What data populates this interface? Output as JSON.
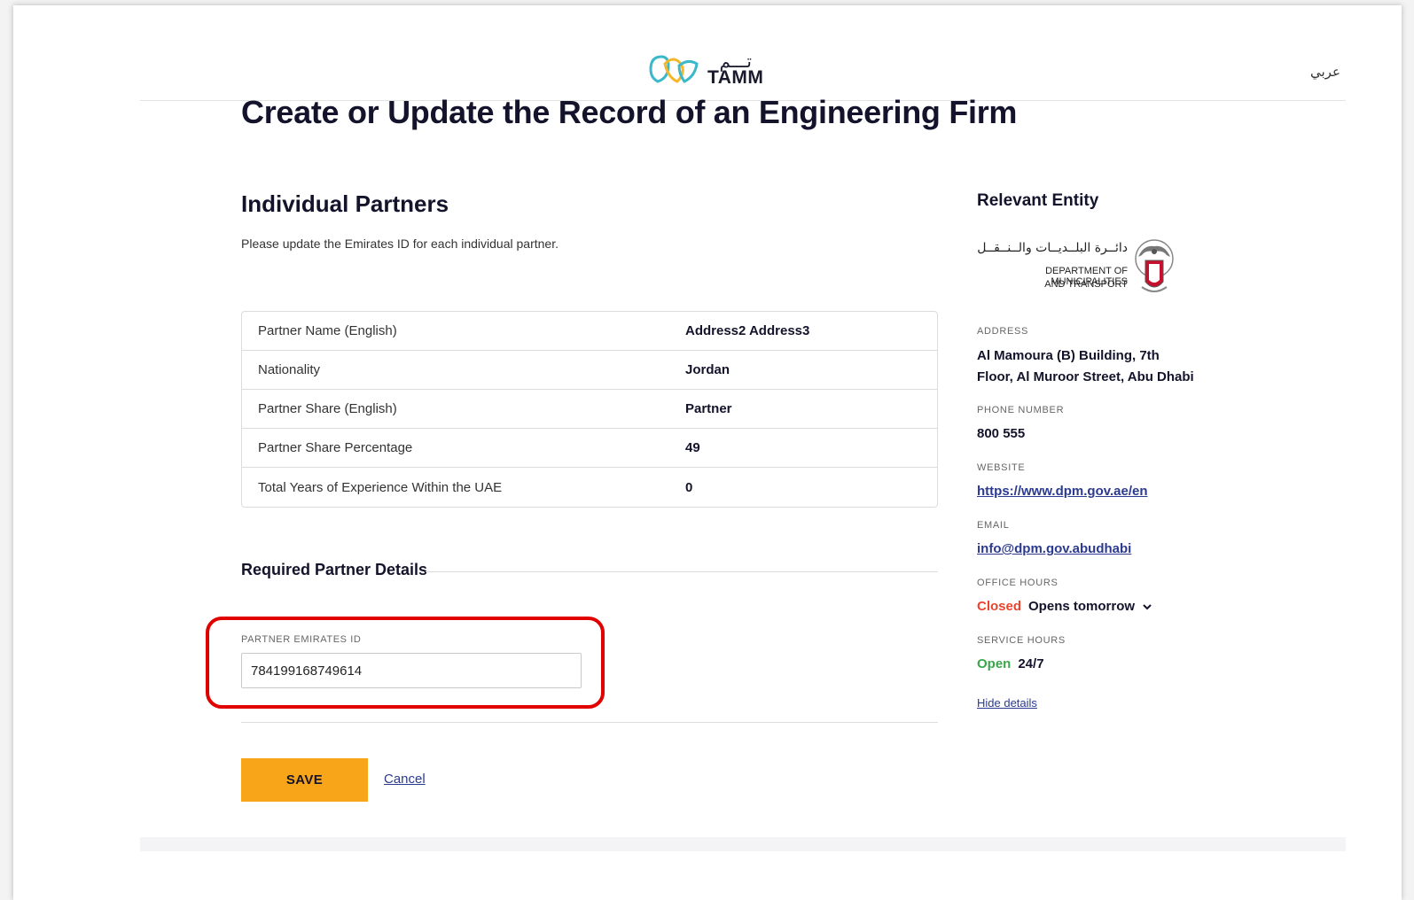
{
  "header": {
    "logo_ar": "تـــم",
    "logo_en": "TAMM",
    "language_toggle": "عربي"
  },
  "page": {
    "title": "Create or Update the Record of an Engineering Firm"
  },
  "partners_section": {
    "title": "Individual Partners",
    "description": "Please update the Emirates ID for each individual partner.",
    "rows": [
      {
        "label": "Partner Name (English)",
        "value": "Address2 Address3"
      },
      {
        "label": "Nationality",
        "value": "Jordan"
      },
      {
        "label": "Partner Share (English)",
        "value": "Partner"
      },
      {
        "label": "Partner Share Percentage",
        "value": "49"
      },
      {
        "label": "Total Years of Experience Within the UAE",
        "value": "0"
      }
    ]
  },
  "required_section": {
    "title": "Required Partner Details",
    "emirates_id_label": "PARTNER EMIRATES ID",
    "emirates_id_value": "784199168749614"
  },
  "actions": {
    "save_label": "SAVE",
    "cancel_label": "Cancel"
  },
  "entity": {
    "title": "Relevant Entity",
    "logo_ar": "دائــرة البلــديــات والــنــقــل",
    "logo_en_line1": "DEPARTMENT OF MUNICIPALITIES",
    "logo_en_line2": "AND TRANSPORT",
    "address_label": "ADDRESS",
    "address_line1": "Al Mamoura (B) Building, 7th",
    "address_line2": "Floor, Al Muroor Street, Abu Dhabi",
    "phone_label": "PHONE NUMBER",
    "phone_value": "800 555",
    "website_label": "WEBSITE",
    "website_value": "https://www.dpm.gov.ae/en",
    "email_label": "EMAIL",
    "email_value": "info@dpm.gov.abudhabi",
    "office_hours_label": "OFFICE HOURS",
    "office_status": "Closed",
    "office_next": "Opens tomorrow",
    "service_hours_label": "SERVICE HOURS",
    "service_status": "Open",
    "service_hours": "24/7",
    "hide_details": "Hide details"
  },
  "colors": {
    "accent": "#f9a51a",
    "link": "#2b3a8f",
    "closed": "#e8442e",
    "open": "#3aa64a",
    "highlight": "#e00000"
  }
}
